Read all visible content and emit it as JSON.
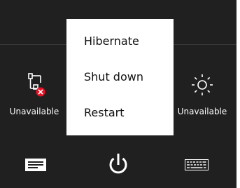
{
  "tiles": [
    {
      "icon": "network-unavailable-icon",
      "label": "Unavailable"
    },
    {
      "icon": "brightness-icon",
      "label": "Unavailable"
    }
  ],
  "power_menu": {
    "items": [
      {
        "label": "Hibernate"
      },
      {
        "label": "Shut down"
      },
      {
        "label": "Restart"
      }
    ]
  },
  "bottom_bar": {
    "icons": [
      "notifications-icon",
      "power-icon",
      "keyboard-icon"
    ]
  },
  "colors": {
    "panel": "#202020",
    "menu": "#ffffff",
    "error": "#e81123",
    "foreground": "#ffffff"
  }
}
